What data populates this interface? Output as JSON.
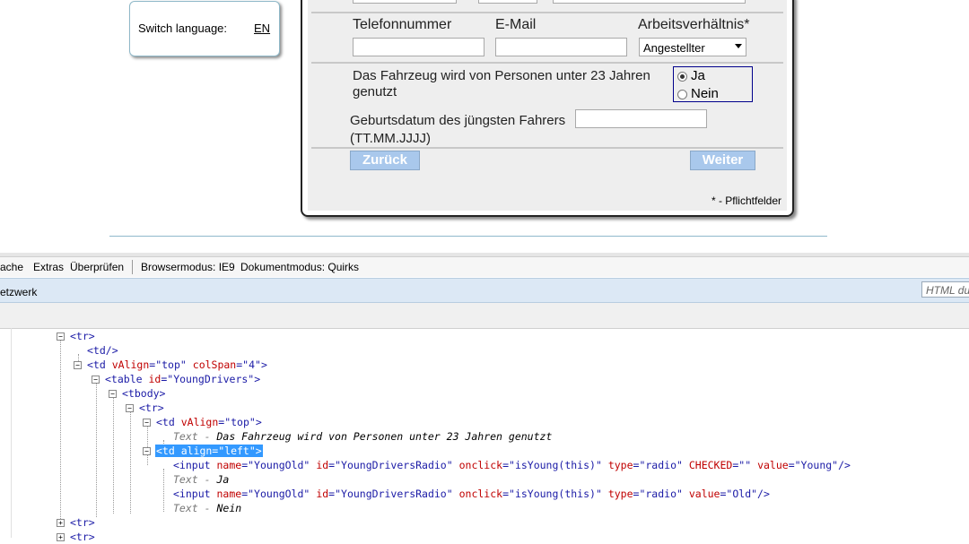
{
  "language_box": {
    "label": "Switch language:",
    "link": "EN"
  },
  "form": {
    "phone_label": "Telefonnummer",
    "email_label": "E-Mail",
    "employment_label": "Arbeitsverhältnis*",
    "employment_value": "Angestellter",
    "young_drivers_question": "Das Fahrzeug wird von Personen unter 23 Jahren genutzt",
    "radio_yes": "Ja",
    "radio_no": "Nein",
    "dob_label": "Geburtsdatum des jüngsten Fahrers (TT.MM.JJJJ)",
    "back_button": "Zurück",
    "next_button": "Weiter",
    "required_note": "* - Pflichtfelder"
  },
  "devtools": {
    "menu": {
      "cache": "ache",
      "extras": "Extras",
      "check": "Überprüfen",
      "browser_mode": "Browsermodus: IE9",
      "document_mode": "Dokumentmodus: Quirks"
    },
    "tab_network": "etzwerk",
    "search_placeholder": "HTML du",
    "tree": {
      "n1": "<tr>",
      "n2": "<td/>",
      "n3_tag": "<td",
      "n3_a1": "vAlign",
      "n3_v1": "\"top\"",
      "n3_a2": "colSpan",
      "n3_v2": "\"4\"",
      "n4_tag": "<table",
      "n4_a1": "id",
      "n4_v1": "\"YoungDrivers\"",
      "n5": "<tbody>",
      "n6": "<tr>",
      "n7_tag": "<td",
      "n7_a1": "vAlign",
      "n7_v1": "\"top\"",
      "n8_prefix": "Text -",
      "n8_value": "Das Fahrzeug wird von Personen unter 23 Jahren genutzt",
      "n9": "<td align=\"left\">",
      "n10_tag": "<input",
      "n10_a1": "name",
      "n10_v1": "\"YoungOld\"",
      "n10_a2": "id",
      "n10_v2": "\"YoungDriversRadio\"",
      "n10_a3": "onclick",
      "n10_v3": "\"isYoung(this)\"",
      "n10_a4": "type",
      "n10_v4": "\"radio\"",
      "n10_a5": "CHECKED",
      "n10_v5": "\"\"",
      "n10_a6": "value",
      "n10_v6": "\"Young\"",
      "n11_prefix": "Text -",
      "n11_value": "Ja",
      "n12_tag": "<input",
      "n12_a1": "name",
      "n12_v1": "\"YoungOld\"",
      "n12_a2": "id",
      "n12_v2": "\"YoungDriversRadio\"",
      "n12_a3": "onclick",
      "n12_v3": "\"isYoung(this)\"",
      "n12_a4": "type",
      "n12_v4": "\"radio\"",
      "n12_a5": "value",
      "n12_v5": "\"Old\"",
      "n13_prefix": "Text -",
      "n13_value": "Nein",
      "n14": "<tr>",
      "n15": "<tr>"
    }
  },
  "colors": {
    "button_bg": "#a9c8ec",
    "selection": "#3399ff",
    "radio_border": "#00008b"
  }
}
